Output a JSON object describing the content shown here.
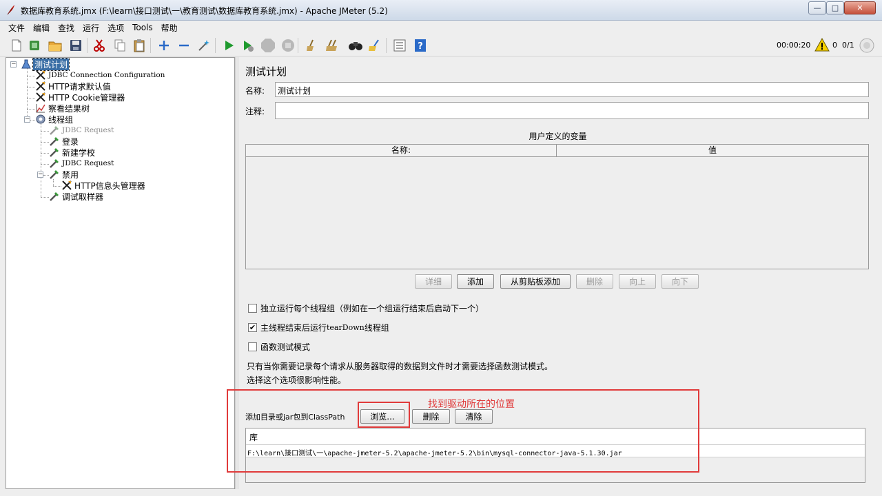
{
  "window": {
    "title": "数据库教育系统.jmx (F:\\learn\\接口测试\\一\\教育测试\\数据库教育系统.jmx) - Apache JMeter (5.2)",
    "min_glyph": "—",
    "max_glyph": "□",
    "close_glyph": "✕"
  },
  "menu": [
    "文件",
    "编辑",
    "查找",
    "运行",
    "选项",
    "Tools",
    "帮助"
  ],
  "toolbar": {
    "timer": "00:00:20",
    "warning_count": "0",
    "threads": "0/1"
  },
  "tree": {
    "root": "测试计划",
    "jdbc_config": "JDBC Connection Configuration",
    "http_defaults": "HTTP请求默认值",
    "cookie_manager": "HTTP Cookie管理器",
    "results_tree": "察看结果树",
    "thread_group": "线程组",
    "jdbc_request_1": "JDBC Request",
    "login": "登录",
    "new_school": "新建学校",
    "jdbc_request_2": "JDBC Request",
    "disabled": "禁用",
    "header_manager": "HTTP信息头管理器",
    "debug_sampler": "调试取样器"
  },
  "plan": {
    "title": "测试计划",
    "name_label": "名称:",
    "name_value": "测试计划",
    "comment_label": "注释:",
    "comment_value": "",
    "vars_caption": "用户定义的变量",
    "col_name": "名称:",
    "col_value": "值",
    "buttons": {
      "detail": "详细",
      "add": "添加",
      "add_clipboard": "从剪贴板添加",
      "delete": "删除",
      "up": "向上",
      "down": "向下"
    },
    "check_independent": "独立运行每个线程组（例如在一个组运行结束后启动下一个）",
    "check_teardown_prefix": "主线程结束后运行 ",
    "check_teardown_mono": "tearDown",
    "check_teardown_suffix": "线程组",
    "check_functional": "函数测试模式",
    "info_line1": "只有当你需要记录每个请求从服务器取得的数据到文件时才需要选择函数测试模式。",
    "info_line2": "选择这个选项很影响性能。",
    "classpath_label": "添加目录或jar包到ClassPath",
    "browse": "浏览...",
    "cp_delete": "删除",
    "cp_clear": "清除",
    "lib_header": "库",
    "lib_path": "F:\\learn\\接口测试\\一\\apache-jmeter-5.2\\apache-jmeter-5.2\\bin\\mysql-connector-java-5.1.30.jar"
  },
  "annotation": {
    "text": "找到驱动所在的位置",
    "color": "#e03a3a"
  },
  "icons": {
    "check": "✔"
  }
}
